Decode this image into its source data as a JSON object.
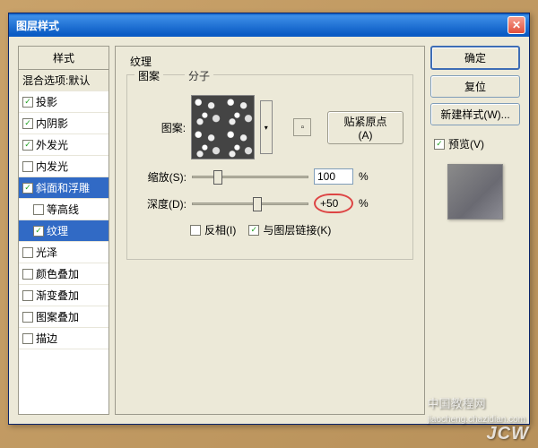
{
  "window": {
    "title": "图层样式"
  },
  "styles_panel": {
    "header": "样式",
    "blend": "混合选项:默认",
    "items": [
      {
        "label": "投影",
        "checked": true
      },
      {
        "label": "内阴影",
        "checked": true
      },
      {
        "label": "外发光",
        "checked": true
      },
      {
        "label": "内发光",
        "checked": false
      },
      {
        "label": "斜面和浮雕",
        "checked": true,
        "selected": true
      },
      {
        "label": "等高线",
        "checked": false,
        "sub": true
      },
      {
        "label": "纹理",
        "checked": true,
        "sub": true,
        "selected": true
      },
      {
        "label": "光泽",
        "checked": false
      },
      {
        "label": "颜色叠加",
        "checked": false
      },
      {
        "label": "渐变叠加",
        "checked": false
      },
      {
        "label": "图案叠加",
        "checked": false
      },
      {
        "label": "描边",
        "checked": false
      }
    ]
  },
  "texture": {
    "title": "纹理",
    "pattern_group": "图案",
    "molecule_label": "分子",
    "pattern_label": "图案:",
    "snap_btn": "贴紧原点(A)",
    "scale_label": "缩放(S):",
    "scale_value": "100",
    "scale_unit": "%",
    "depth_label": "深度(D):",
    "depth_value": "+50",
    "depth_unit": "%",
    "invert_label": "反相(I)",
    "invert_checked": false,
    "link_label": "与图层链接(K)",
    "link_checked": true
  },
  "right": {
    "ok": "确定",
    "cancel": "复位",
    "new_style": "新建样式(W)...",
    "preview": "预览(V)",
    "preview_checked": true
  },
  "watermark": {
    "cn": "中国教程网",
    "url": "jiaocheng.chazidian.com",
    "logo": "JCW"
  }
}
